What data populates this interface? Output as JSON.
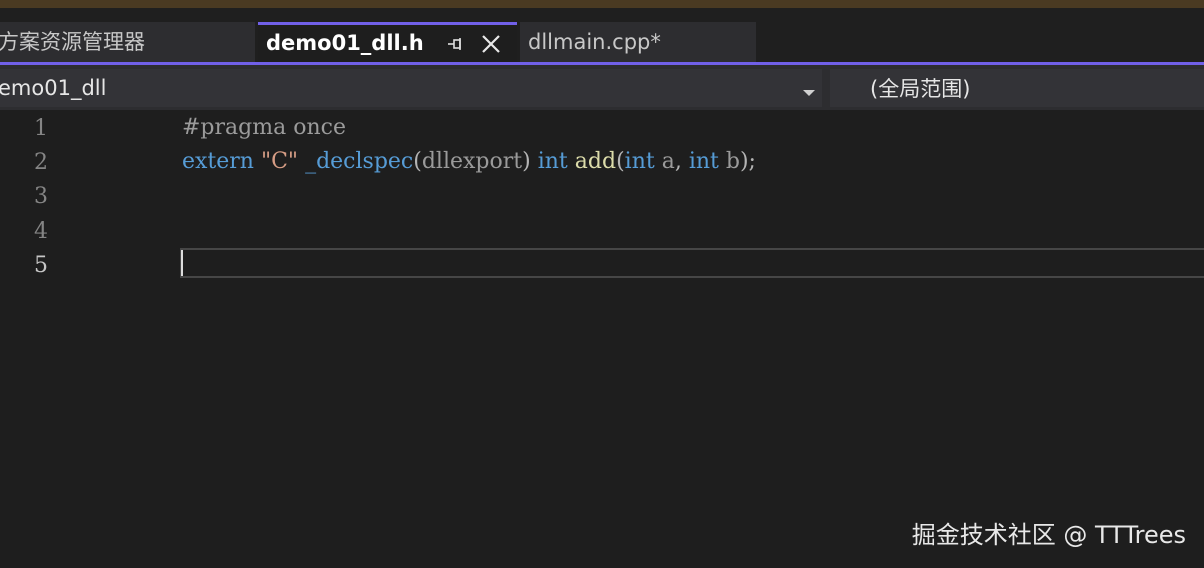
{
  "tabs": {
    "solution_explorer": "方案资源管理器",
    "active": "demo01_dll.h",
    "dllmain": "dllmain.cpp*"
  },
  "navbar": {
    "project": "emo01_dll",
    "scope": "(全局范围)"
  },
  "editor": {
    "line_numbers": [
      "1",
      "2",
      "3",
      "4",
      "5"
    ],
    "current_line": 5,
    "lines": {
      "l1": {
        "pre": "#pragma once"
      },
      "l2": {
        "extern": "extern",
        "space1": " ",
        "str": "\"C\"",
        "space2": " ",
        "declspec": "_declspec",
        "lparen": "(",
        "dllexport": "dllexport",
        "rparen": ")",
        "space3": " ",
        "int1": "int",
        "space4": " ",
        "fn": "add",
        "lparen2": "(",
        "int2": "int",
        "space5": " ",
        "a": "a",
        "comma": ",",
        "space6": " ",
        "int3": "int",
        "space7": " ",
        "b": "b",
        "end": ");"
      }
    }
  },
  "watermark": "掘金技术社区 @ TTTrees",
  "colors": {
    "accent": "#7160e8",
    "keyword": "#569cd6",
    "string": "#d69d85",
    "function": "#dcdcaa"
  }
}
